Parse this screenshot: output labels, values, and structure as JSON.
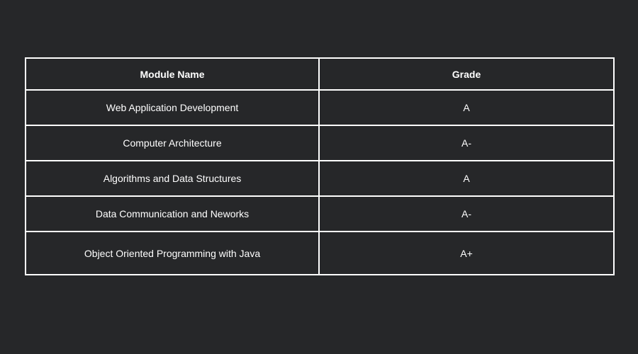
{
  "table": {
    "headers": [
      "Module Name",
      "Grade"
    ],
    "rows": [
      [
        "Web Application Development",
        "A"
      ],
      [
        "Computer Architecture",
        "A-"
      ],
      [
        "Algorithms and Data Structures",
        "A"
      ],
      [
        "Data Communication and Neworks",
        "A-"
      ],
      [
        "Object Oriented Programming with Java",
        "A+"
      ]
    ]
  },
  "colors": {
    "background": "#262729",
    "border": "#ffffff",
    "text": "#ffffff"
  }
}
